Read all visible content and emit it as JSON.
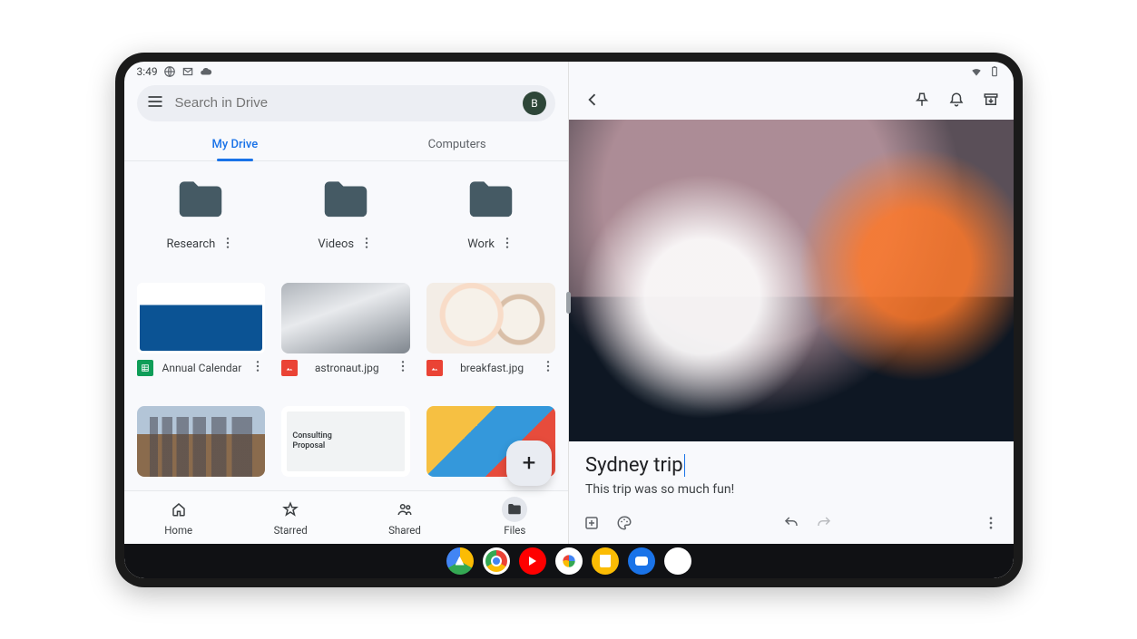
{
  "status": {
    "time": "3:49",
    "icons": [
      "globe-icon",
      "gmail-icon",
      "cloud-icon"
    ],
    "right_icons": [
      "wifi-icon",
      "battery-icon"
    ]
  },
  "search": {
    "placeholder": "Search in Drive",
    "avatar_initial": "B"
  },
  "tabs": {
    "my_drive": "My Drive",
    "computers": "Computers"
  },
  "folders": [
    {
      "name": "Research"
    },
    {
      "name": "Videos"
    },
    {
      "name": "Work"
    }
  ],
  "files": [
    {
      "name": "Annual Calendar",
      "type": "sheets"
    },
    {
      "name": "astronaut.jpg",
      "type": "image"
    },
    {
      "name": "breakfast.jpg",
      "type": "image"
    }
  ],
  "partial_files": {
    "proposal_line1": "Consulting",
    "proposal_line2": "Proposal"
  },
  "nav": {
    "home": "Home",
    "starred": "Starred",
    "shared": "Shared",
    "files": "Files"
  },
  "fab": "+",
  "keep": {
    "title": "Sydney trip",
    "body": "This trip was so much fun!"
  },
  "taskbar": [
    "drive",
    "chrome",
    "youtube",
    "photos",
    "keep",
    "messages",
    "apps"
  ]
}
